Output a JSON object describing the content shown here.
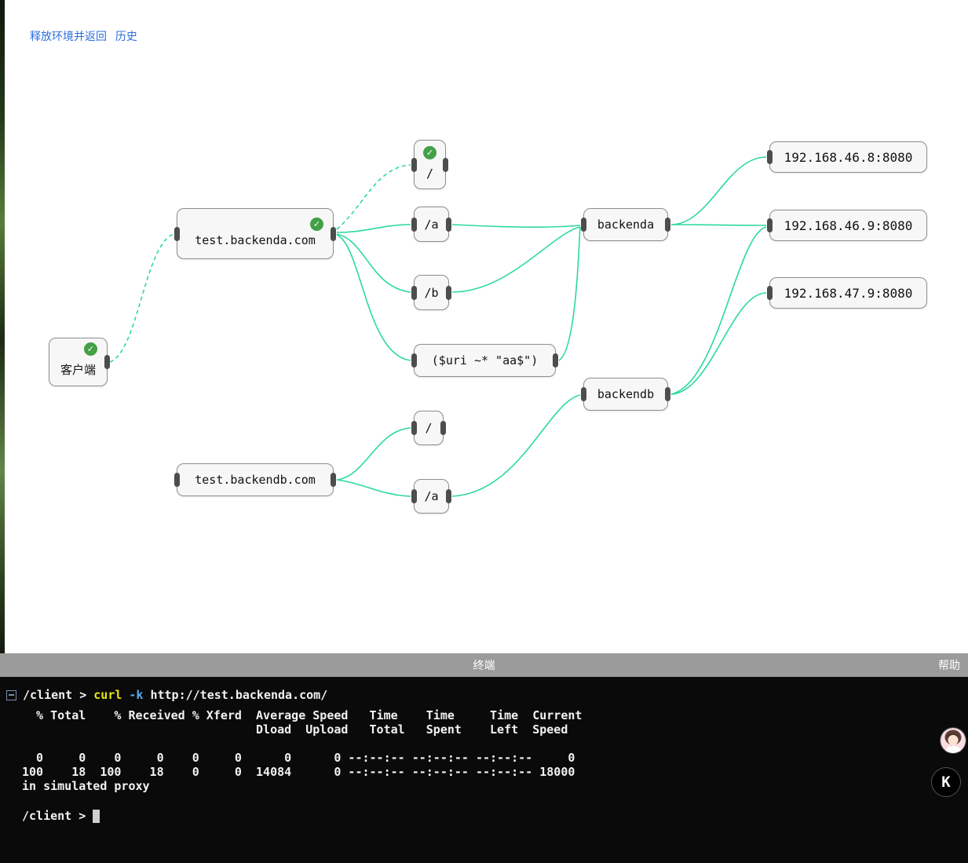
{
  "header": {
    "release_link": "释放环境并返回",
    "history_link": "历史"
  },
  "icons": {
    "check": "✓",
    "collapse": "minus-box",
    "cursor": "block-cursor"
  },
  "colors": {
    "edge": "#2bd9a0",
    "check_green": "#43a047",
    "command_yellow": "#e5e510",
    "flag_blue": "#59a7f2",
    "link_blue": "#2c6fdd",
    "terminal_bar_gray": "#9b9b9b"
  },
  "graph": {
    "nodes": {
      "client": {
        "label": "客户端"
      },
      "hostA": {
        "label": "test.backenda.com"
      },
      "locRoot": {
        "label": "/"
      },
      "locA": {
        "label": "/a"
      },
      "locB": {
        "label": "/b"
      },
      "locRegex": {
        "label": "($uri ~* \"aa$\")"
      },
      "upstreamA": {
        "label": "backenda"
      },
      "upstreamB": {
        "label": "backendb"
      },
      "server1": {
        "label": "192.168.46.8:8080"
      },
      "server2": {
        "label": "192.168.46.9:8080"
      },
      "server3": {
        "label": "192.168.47.9:8080"
      },
      "hostB": {
        "label": "test.backendb.com"
      },
      "locRootB": {
        "label": "/"
      },
      "locAB": {
        "label": "/a"
      }
    }
  },
  "terminal": {
    "titlebar": {
      "title": "终端",
      "help": "帮助"
    },
    "prompt_prefix": "/client >",
    "command": {
      "name": "curl",
      "flag": "-k",
      "arg": "http://test.backenda.com/"
    },
    "output": "  % Total    % Received % Xferd  Average Speed   Time    Time     Time  Current\n                                 Dload  Upload   Total   Spent    Left  Speed\n\n  0     0    0     0    0     0      0      0 --:--:-- --:--:-- --:--:--     0\n100    18  100    18    0     0  14084      0 --:--:-- --:--:-- --:--:-- 18000\nin simulated proxy"
  },
  "widgets": {
    "k_badge": "K"
  }
}
